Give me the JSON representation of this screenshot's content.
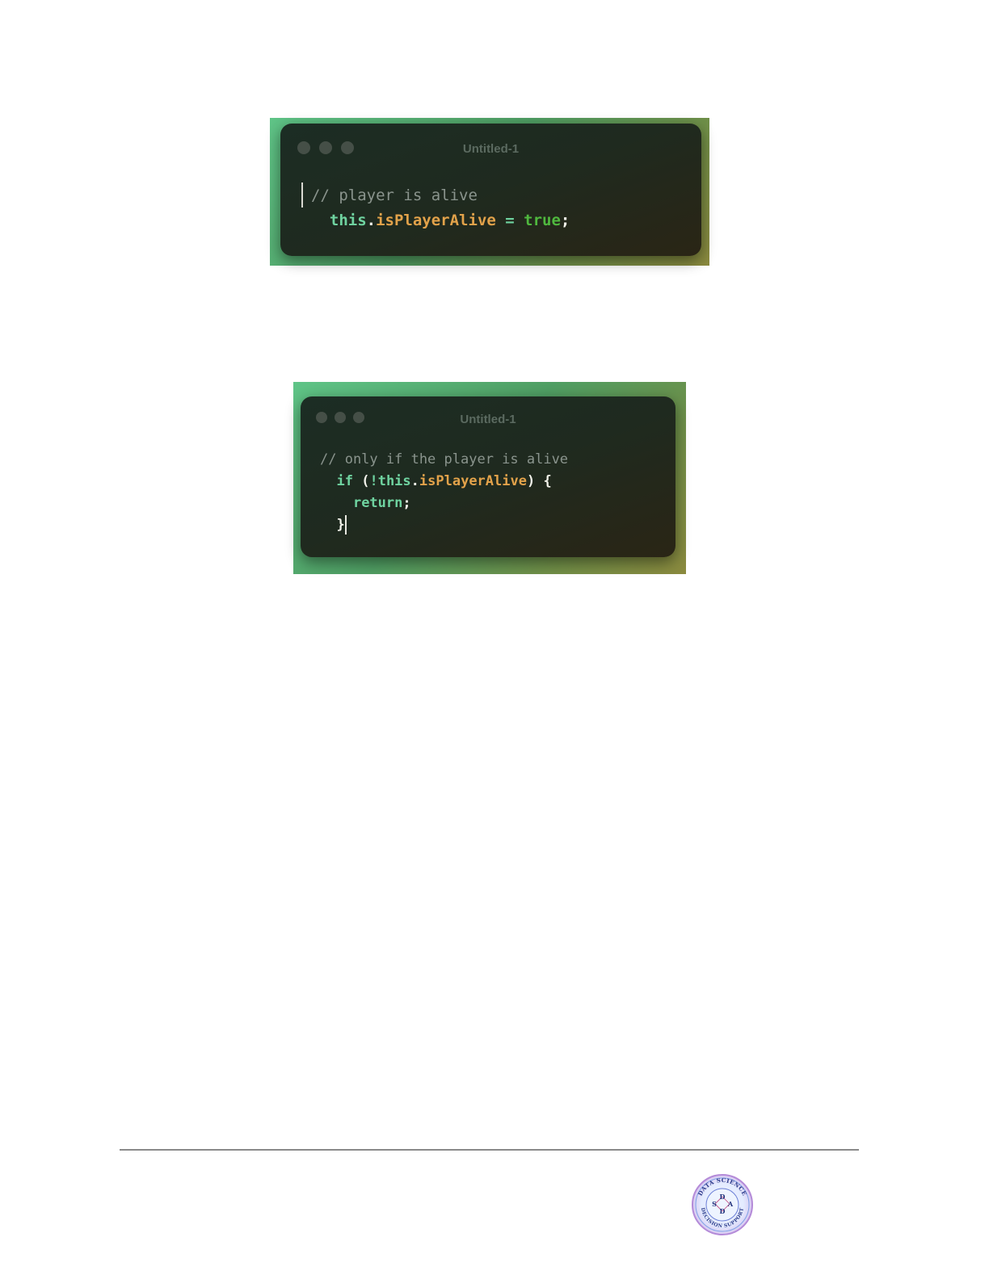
{
  "snippets": [
    {
      "window_title": "Untitled-1",
      "lines": [
        {
          "comment": "// player is alive"
        },
        {
          "kw": "this",
          "dot": ".",
          "prop": "isPlayerAlive",
          "op": " = ",
          "bool": "true",
          "end": ";"
        }
      ]
    },
    {
      "window_title": "Untitled-1",
      "lines": [
        {
          "comment": "// only if the player is alive"
        },
        {
          "kw": "if",
          "open": " (",
          "op": "!",
          "kw2": "this",
          "dot": ".",
          "prop": "isPlayerAlive",
          "close": ") {"
        },
        {
          "kw": "return",
          "end": ";"
        },
        {
          "brace": "}"
        }
      ]
    }
  ],
  "logo": {
    "top_text": "DATA SCIENCE",
    "bottom_text": "DECISION SUPPORT",
    "letters": [
      "D",
      "S",
      "A",
      "D"
    ]
  },
  "colors": {
    "comment": "#8a948d",
    "keyword": "#6fd3a0",
    "property": "#e2a24a",
    "boolean": "#4fb83e"
  }
}
